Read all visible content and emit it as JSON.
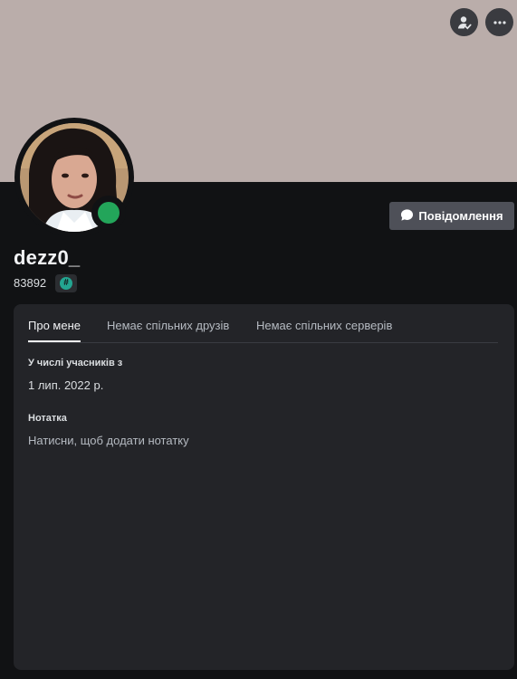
{
  "banner": {
    "color": "#baadaa"
  },
  "header_buttons": [
    {
      "icon": "add-friend-icon"
    },
    {
      "icon": "more-options-icon"
    }
  ],
  "profile": {
    "username": "dezz0_",
    "discriminator": "83892",
    "badge_symbol": "#",
    "status": "online",
    "status_color": "#23a55a"
  },
  "message_button": {
    "label": "Повідомлення",
    "icon": "message-bubble-icon"
  },
  "tabs": [
    {
      "label": "Про мене",
      "active": true
    },
    {
      "label": "Немає спільних друзів",
      "active": false
    },
    {
      "label": "Немає спільних серверів",
      "active": false
    }
  ],
  "about": {
    "member_since_title": "У числі учасників з",
    "member_since_value": "1 лип. 2022 р.",
    "note_title": "Нотатка",
    "note_placeholder": "Натисни, щоб додати нотатку"
  }
}
